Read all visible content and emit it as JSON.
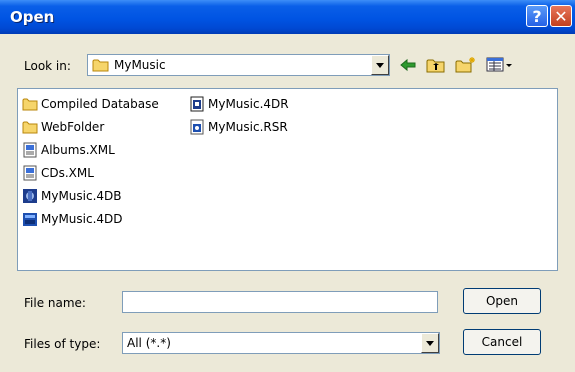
{
  "dialog": {
    "title": "Open",
    "help_glyph": "?",
    "close_glyph": "✕"
  },
  "look_in": {
    "label": "Look in:",
    "value": "MyMusic",
    "folder_icon": "folder-icon"
  },
  "toolbar": {
    "back_icon": "back-arrow-icon",
    "up_icon": "up-folder-icon",
    "new_folder_icon": "new-folder-icon",
    "views_icon": "view-menu-icon"
  },
  "files": [
    {
      "name": "Compiled Database",
      "icon": "folder-icon"
    },
    {
      "name": "WebFolder",
      "icon": "folder-icon"
    },
    {
      "name": "Albums.XML",
      "icon": "xml-file-icon"
    },
    {
      "name": "CDs.XML",
      "icon": "xml-file-icon"
    },
    {
      "name": "MyMusic.4DB",
      "icon": "4db-file-icon"
    },
    {
      "name": "MyMusic.4DD",
      "icon": "4dd-file-icon"
    },
    {
      "name": "MyMusic.4DR",
      "icon": "4dr-file-icon"
    },
    {
      "name": "MyMusic.RSR",
      "icon": "rsr-file-icon"
    }
  ],
  "file_name": {
    "label": "File name:",
    "value": ""
  },
  "files_of_type": {
    "label": "Files of type:",
    "value": "All (*.*)"
  },
  "buttons": {
    "open": "Open",
    "cancel": "Cancel"
  },
  "colors": {
    "titlebar": "#0054e3",
    "dialog_bg": "#ece9d8",
    "close_button": "#c2401e"
  }
}
